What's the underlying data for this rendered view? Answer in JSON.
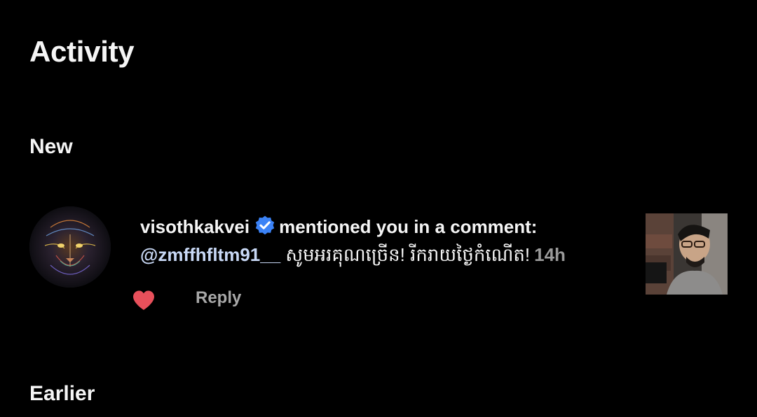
{
  "header": {
    "title": "Activity"
  },
  "sections": {
    "new_label": "New",
    "earlier_label": "Earlier"
  },
  "notification": {
    "username": "visothkakvei",
    "verified_icon": "verified-badge-icon",
    "action_text": "mentioned you in a comment:",
    "mention": "@zmffhfltm91__",
    "comment_text": "សូមអរគុណច្រើន! រីករាយថ្ងៃកំណើត!",
    "time": "14h",
    "like_icon": "heart-icon",
    "like_color": "#e8505b",
    "reply_label": "Reply",
    "avatar": "tiger-avatar",
    "thumbnail": "post-thumbnail"
  },
  "colors": {
    "background": "#000000",
    "text": "#f5f5f5",
    "verified": "#3b82f6",
    "muted": "#9a9a9a"
  }
}
